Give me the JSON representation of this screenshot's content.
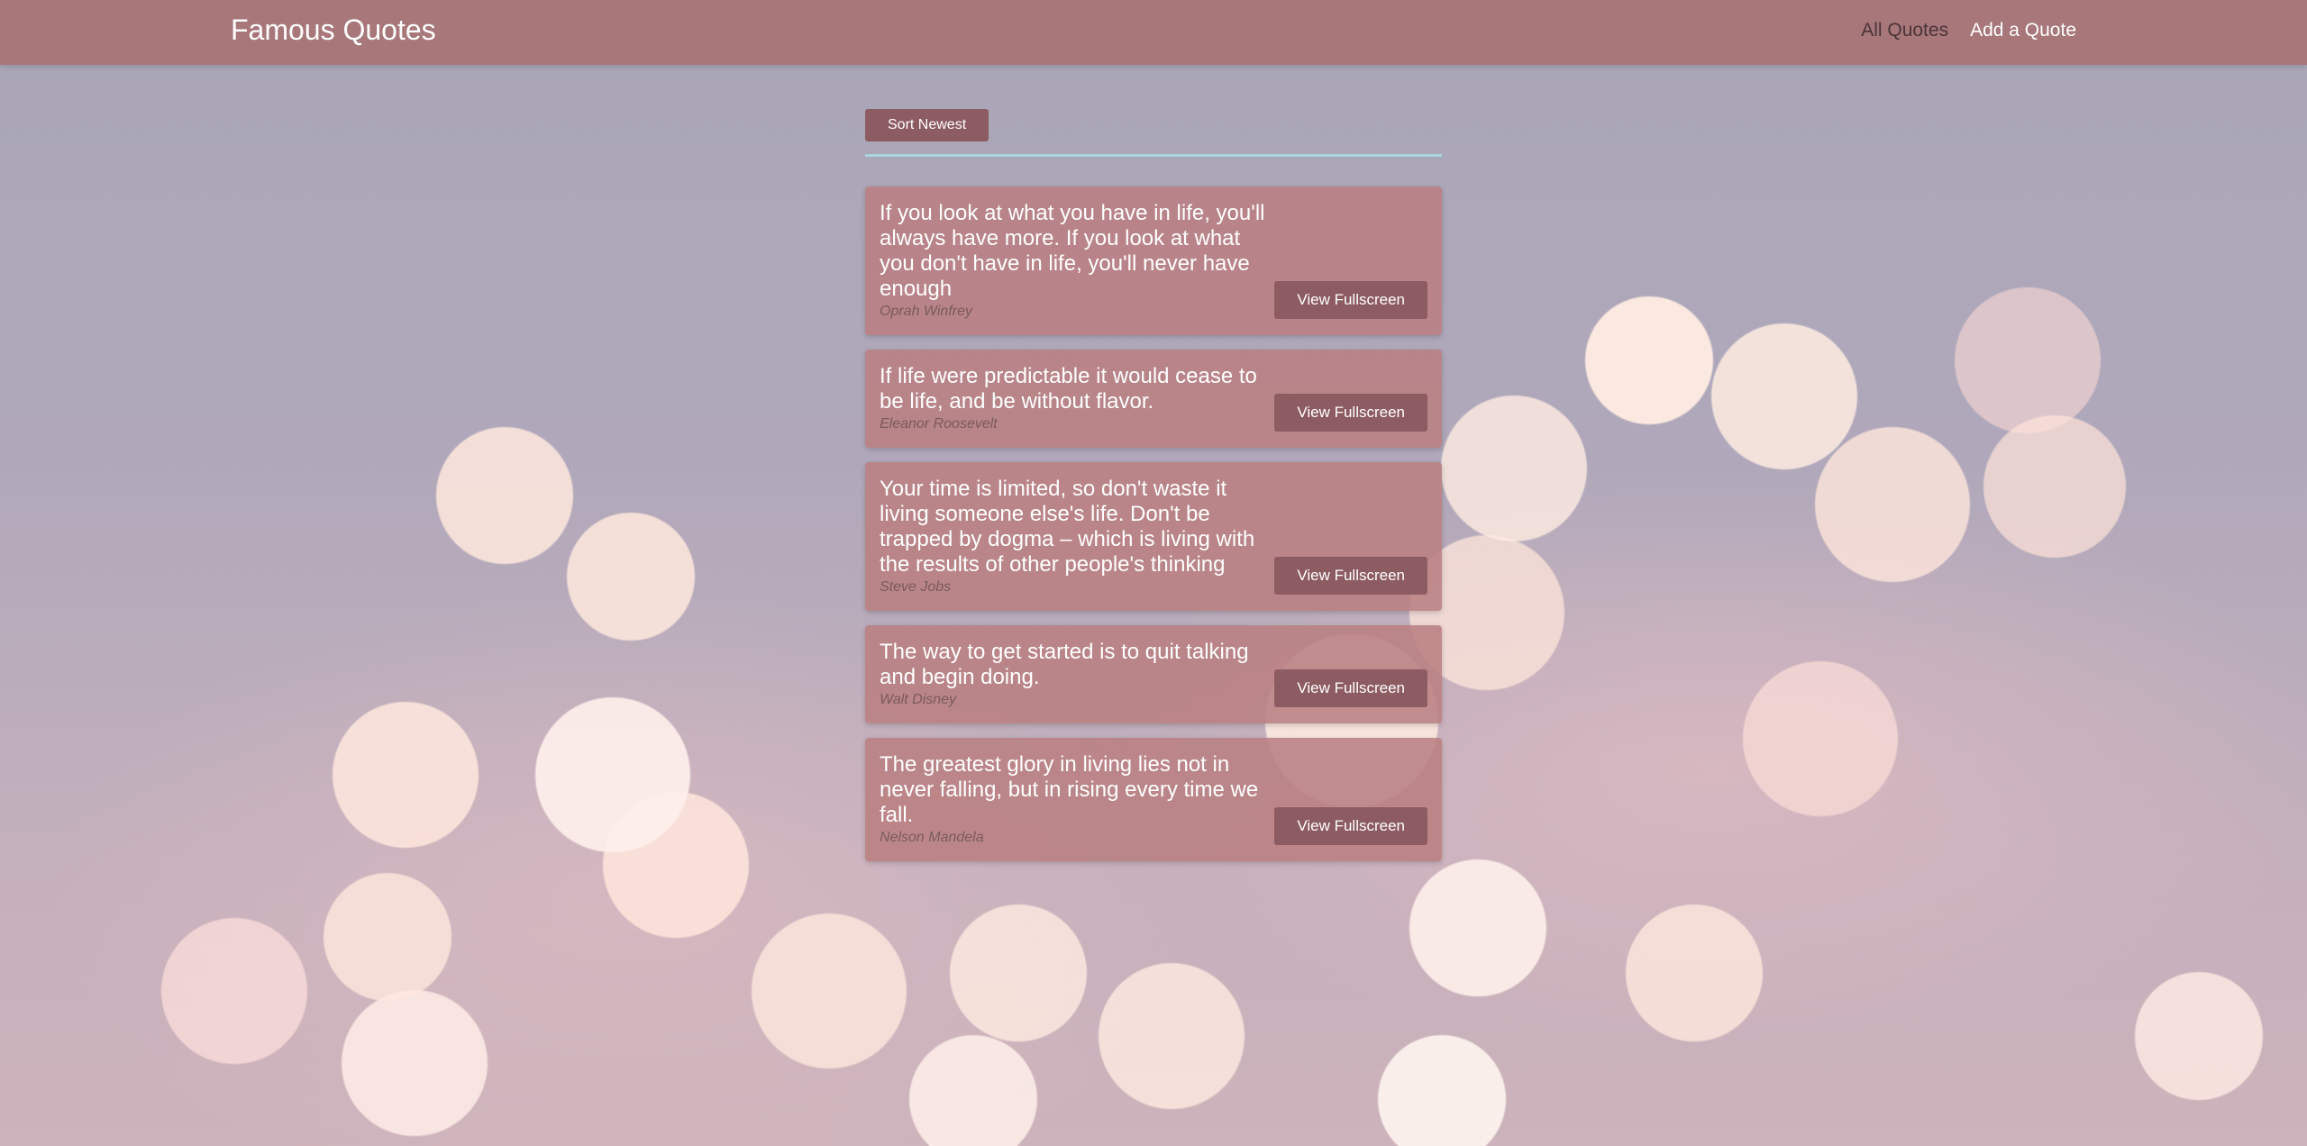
{
  "navbar": {
    "brand": "Famous Quotes",
    "links": [
      {
        "label": "All Quotes"
      },
      {
        "label": "Add a Quote"
      }
    ]
  },
  "controls": {
    "sort_label": "Sort Newest"
  },
  "quotes": [
    {
      "text": "If you look at what you have in life, you'll always have more. If you look at what you don't have in life, you'll never have enough",
      "author": "Oprah Winfrey",
      "button": "View Fullscreen"
    },
    {
      "text": "If life were predictable it would cease to be life, and be without flavor.",
      "author": "Eleanor Roosevelt",
      "button": "View Fullscreen"
    },
    {
      "text": "Your time is limited, so don't waste it living someone else's life. Don't be trapped by dogma – which is living with the results of other people's thinking",
      "author": "Steve Jobs",
      "button": "View Fullscreen"
    },
    {
      "text": "The way to get started is to quit talking and begin doing.",
      "author": "Walt Disney",
      "button": "View Fullscreen"
    },
    {
      "text": "The greatest glory in living lies not in never falling, but in rising every time we fall.",
      "author": "Nelson Mandela",
      "button": "View Fullscreen"
    }
  ],
  "colors": {
    "navbar": "#a7777a",
    "button": "#8d5c62",
    "card": "#b98082",
    "divider": "#a9d4dc"
  }
}
